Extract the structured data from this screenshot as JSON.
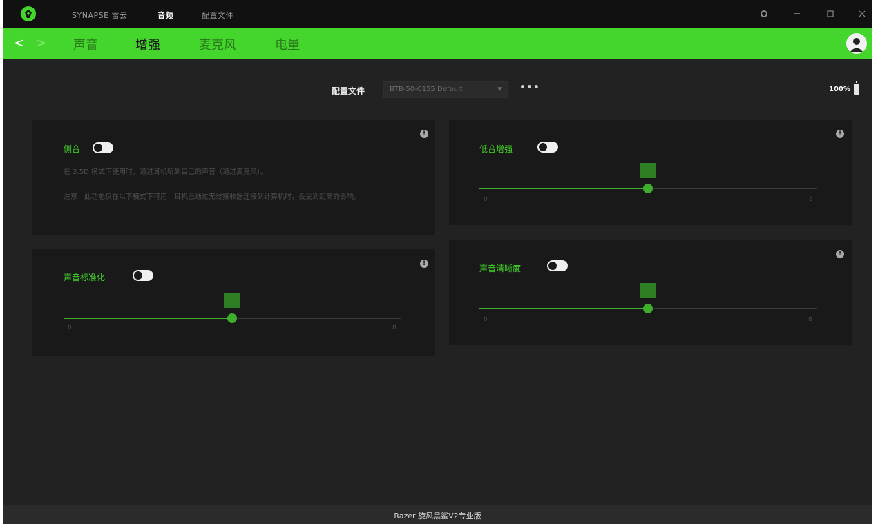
{
  "titlebar": {
    "tabs": [
      "SYNAPSE 雷云",
      "音频",
      "配置文件"
    ],
    "active_tab": 1
  },
  "navbar": {
    "back": "<",
    "forward": ">",
    "tabs": [
      "声音",
      "增强",
      "麦克风",
      "电量"
    ],
    "active_tab": 1
  },
  "profile": {
    "label": "配置文件",
    "value": "BTB-50-C155 Default",
    "chevron": "▾",
    "more": "•••"
  },
  "battery": {
    "text": "100%",
    "level": 1.0
  },
  "cards": {
    "sidetone": {
      "title": "侧音",
      "enabled": false,
      "desc1": "在 3.5D 模式下使用时，通过耳机听到自己的声音（通过麦克风）。",
      "desc2": "注意：此功能仅在以下模式下可用：耳机已通过无线接收器连接到计算机时，会受到距离的影响。"
    },
    "bass": {
      "title": "低音增强",
      "enabled": false,
      "value": "",
      "level": 0.5,
      "min": "0",
      "max": "8"
    },
    "normalization": {
      "title": "声音标准化",
      "enabled": false,
      "value": "",
      "level": 0.5,
      "min": "0",
      "max": "8"
    },
    "clarity": {
      "title": "声音清晰度",
      "enabled": false,
      "value": "",
      "level": 0.5,
      "min": "0",
      "max": "8"
    }
  },
  "footer": {
    "device": "Razer 旋风黑鲨V2专业版"
  },
  "colors": {
    "accent": "#44d62c",
    "background": "#222222",
    "card": "#191919"
  }
}
